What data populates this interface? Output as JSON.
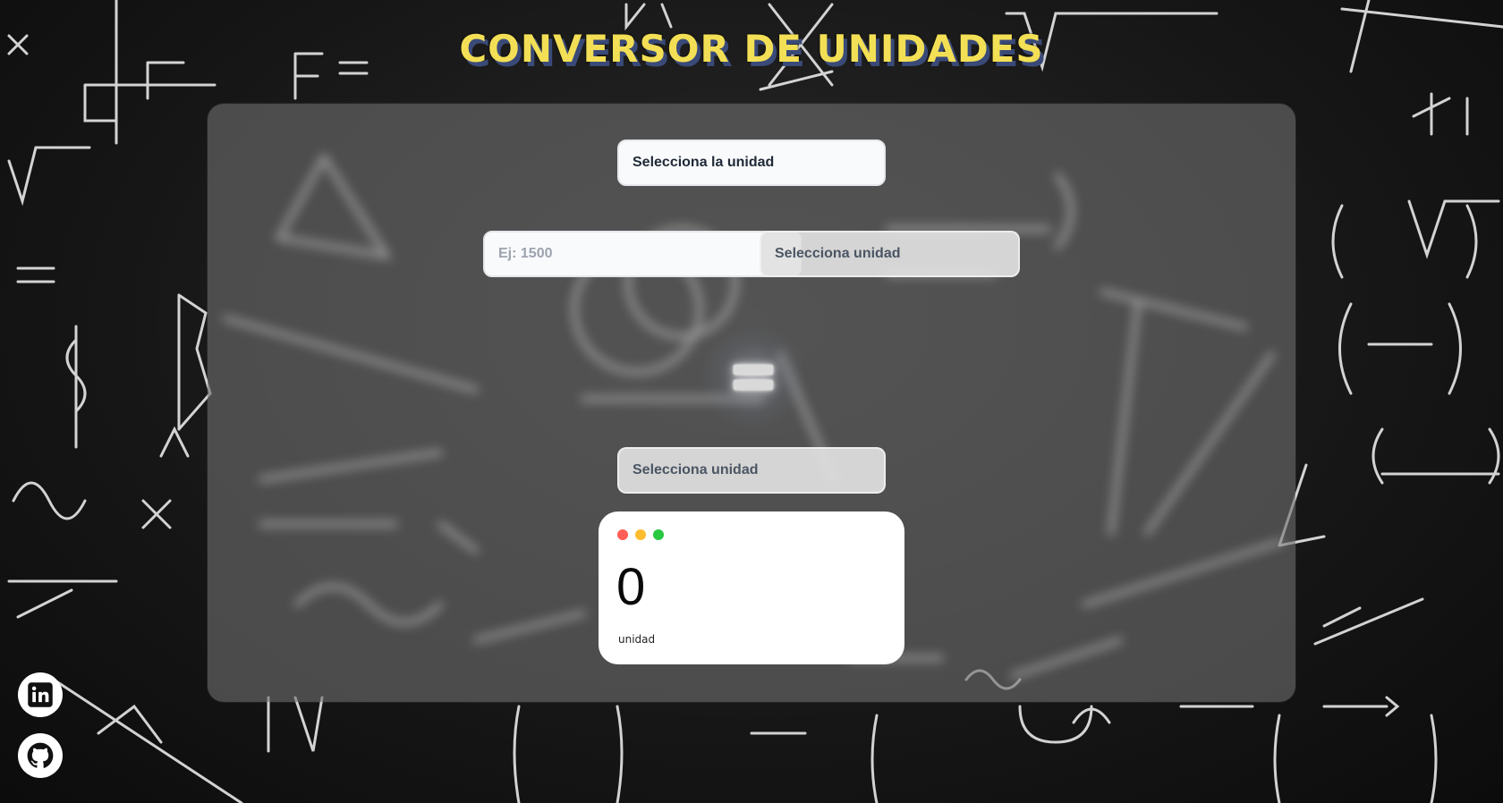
{
  "header": {
    "title": "CONVERSOR DE UNIDADES"
  },
  "converter": {
    "category_select": {
      "value": "Selecciona la unidad"
    },
    "amount_input": {
      "placeholder": "Ej: 1500",
      "value": ""
    },
    "from_unit_select": {
      "value": "Selecciona unidad"
    },
    "equals_symbol": "=",
    "to_unit_select": {
      "value": "Selecciona unidad"
    }
  },
  "result": {
    "value": "0",
    "unit": "unidad"
  },
  "social": {
    "linkedin_icon": "linkedin-icon",
    "github_icon": "github-icon"
  },
  "colors": {
    "title": "#f3df55",
    "title_shadow": "#3a4a78",
    "dot_red": "#ff5f57",
    "dot_yellow": "#febc2e",
    "dot_green": "#28c840"
  }
}
